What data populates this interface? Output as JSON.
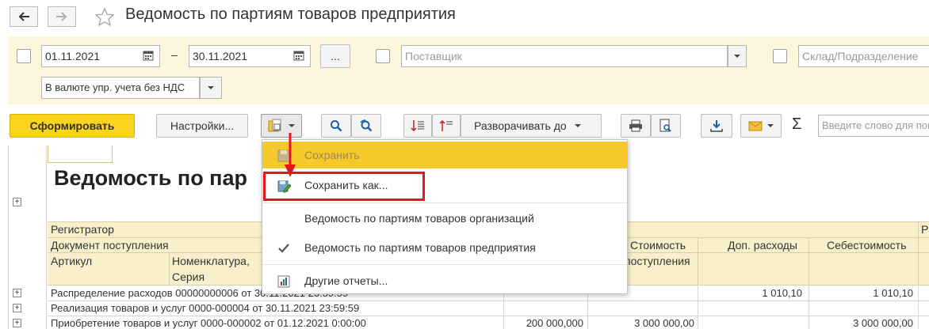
{
  "window": {
    "title": "Ведомость по партиям товаров предприятия"
  },
  "filters": {
    "date_from": "01.11.2021",
    "date_sep": "–",
    "date_to": "30.11.2021",
    "period_button": "...",
    "supplier_placeholder": "Поставщик",
    "warehouse_placeholder": "Склад/Подразделение",
    "currency": "В валюте упр. учета без НДС"
  },
  "toolbar": {
    "generate": "Сформировать",
    "settings": "Настройки...",
    "expand_to": "Разворачивать до",
    "sum_symbol": "Σ",
    "search_placeholder": "Введите слово для поиска"
  },
  "menu": {
    "items": [
      {
        "label": "Сохранить",
        "disabled": true,
        "highlighted": true,
        "icon": "save-icon"
      },
      {
        "label": "Сохранить как...",
        "disabled": false,
        "icon": "save-as-icon"
      },
      {
        "label": "Ведомость по партиям товаров организаций",
        "disabled": false
      },
      {
        "label": "Ведомость по партиям товаров предприятия",
        "disabled": false,
        "checked": true,
        "icon": "checkmark-icon"
      },
      {
        "label": "Другие отчеты...",
        "disabled": false,
        "icon": "other-reports-icon"
      }
    ]
  },
  "report": {
    "title": "Ведомость по пар",
    "headers": {
      "registrator": "Регистратор",
      "receipt_doc": "Документ поступления",
      "article": "Артикул",
      "nomenclature": "Номенклатура,",
      "series": "Серия",
      "cost_line1": "Стоимость",
      "cost_line2": "поступления",
      "add_expenses": "Доп. расходы",
      "prime_cost": "Себестоимость",
      "extra": "Р"
    },
    "rows": [
      {
        "label": "Распределение расходов 00000000006 от 30.11.2021 23:59:59",
        "qty": "",
        "cost": "",
        "add": "1 010,10",
        "prime": "1 010,10"
      },
      {
        "label": "Реализация товаров и услуг 0000-000004 от 30.11.2021 23:59:59",
        "qty": "",
        "cost": "",
        "add": "",
        "prime": ""
      },
      {
        "label": "Приобретение товаров и услуг 0000-000002 от 01.12.2021 0:00:00",
        "qty": "200 000,000",
        "cost": "3 000 000,00",
        "add": "",
        "prime": "3 000 000,00"
      }
    ]
  },
  "colors": {
    "accent_yellow": "#f9d41c",
    "filter_bg": "#fbf6dc",
    "highlight_red": "#e8141b"
  }
}
